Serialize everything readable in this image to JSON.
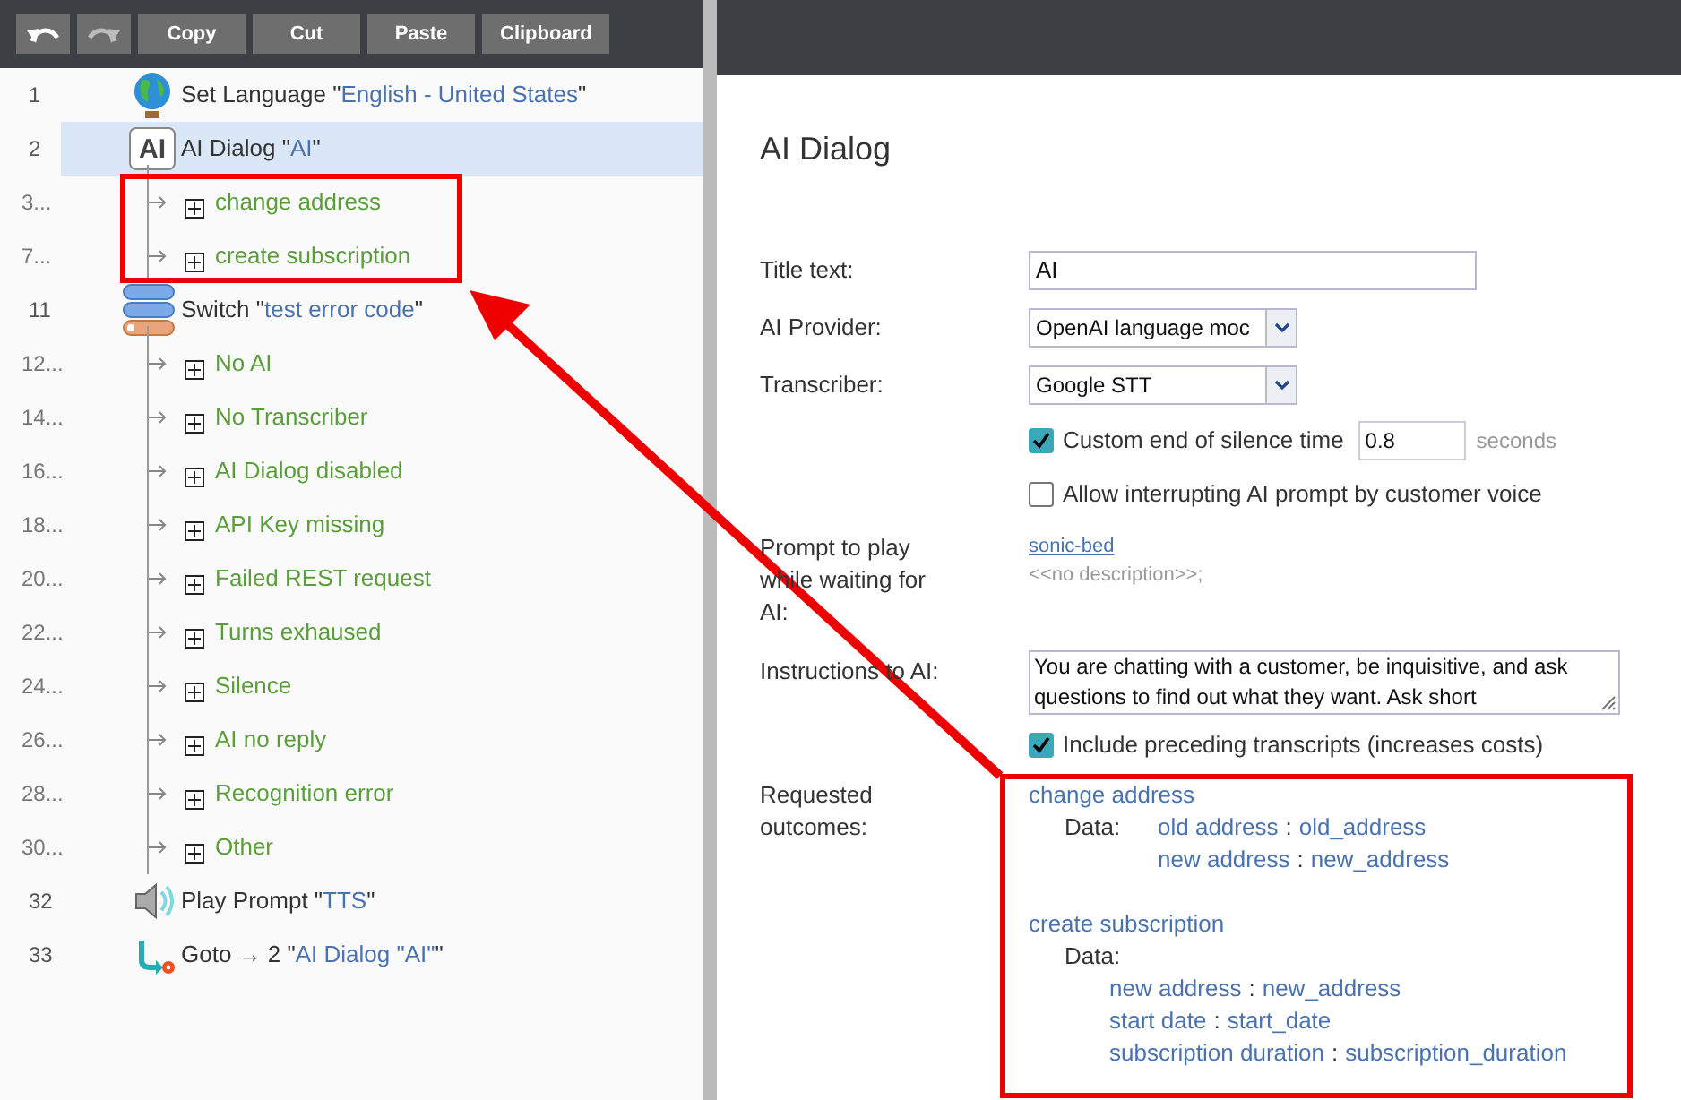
{
  "toolbar": [
    {
      "kind": "undo"
    },
    {
      "kind": "redo"
    },
    {
      "kind": "text",
      "label": "Copy"
    },
    {
      "kind": "text",
      "label": "Cut"
    },
    {
      "kind": "text",
      "label": "Paste"
    },
    {
      "kind": "text",
      "label": "Clipboard"
    }
  ],
  "tree": [
    {
      "number": "1",
      "kind": "language",
      "label": "Set Language \"",
      "value": "English - United States",
      "end": "\"",
      "selected": false
    },
    {
      "number": "2",
      "kind": "ai",
      "icon_text": "AI",
      "label": "AI Dialog \"",
      "value": "AI",
      "end": "\"",
      "selected": true,
      "children": [
        {
          "number": "3...",
          "label": "change address"
        },
        {
          "number": "7...",
          "label": "create subscription"
        }
      ]
    },
    {
      "number": "11",
      "kind": "switch",
      "label": "Switch \"",
      "value": "test error code",
      "end": "\"",
      "selected": false,
      "children": [
        {
          "number": "12...",
          "label": "No AI"
        },
        {
          "number": "14...",
          "label": "No Transcriber"
        },
        {
          "number": "16...",
          "label": "AI Dialog disabled"
        },
        {
          "number": "18...",
          "label": "API Key missing"
        },
        {
          "number": "20...",
          "label": "Failed REST request"
        },
        {
          "number": "22...",
          "label": "Turns exhaused"
        },
        {
          "number": "24...",
          "label": "Silence"
        },
        {
          "number": "26...",
          "label": "AI no reply"
        },
        {
          "number": "28...",
          "label": "Recognition error"
        },
        {
          "number": "30...",
          "label": "Other"
        }
      ]
    },
    {
      "number": "32",
      "kind": "prompt",
      "label": "Play Prompt \"",
      "value": "TTS",
      "end": "\"",
      "selected": false
    },
    {
      "number": "33",
      "kind": "goto",
      "label": "Goto → 2 \"",
      "value": "AI Dialog \"AI\"",
      "end": "\"",
      "selected": false
    }
  ],
  "panel": {
    "title": "AI Dialog",
    "title_text": {
      "label": "Title text:",
      "value": "AI"
    },
    "ai_provider": {
      "label": "AI Provider:",
      "value": "OpenAI language moc"
    },
    "transcriber": {
      "label": "Transcriber:",
      "value": "Google STT"
    },
    "custom_silence": {
      "label": "Custom end of silence time",
      "checked": true,
      "value": "0.8",
      "unit": "seconds"
    },
    "allow_interrupt": {
      "label": "Allow interrupting AI prompt by customer voice",
      "checked": false
    },
    "prompt": {
      "label": "Prompt to play while waiting for AI:",
      "link": "sonic-bed",
      "description": "<<no description>>;"
    },
    "instructions": {
      "label": "Instructions to AI:",
      "value": "You are chatting with a customer, be inquisitive, and ask questions to find out what they want. Ask short"
    },
    "include_transcripts": {
      "label": "Include preceding transcripts (increases costs)",
      "checked": true
    },
    "outcomes": {
      "label": "Requested outcomes:",
      "items": [
        {
          "name": "change address",
          "kind": "inline",
          "data_label": "Data:",
          "separator": ":",
          "data": [
            {
              "key": "old address",
              "value": "old_address"
            },
            {
              "key": "new address",
              "value": "new_address"
            }
          ]
        },
        {
          "name": "create subscription",
          "kind": "stacked",
          "data_label": "Data:",
          "separator": ":",
          "data": [
            {
              "key": "new address",
              "value": "new_address"
            },
            {
              "key": "start date",
              "value": "start_date"
            },
            {
              "key": "subscription duration",
              "value": "subscription_duration"
            }
          ]
        }
      ]
    }
  }
}
